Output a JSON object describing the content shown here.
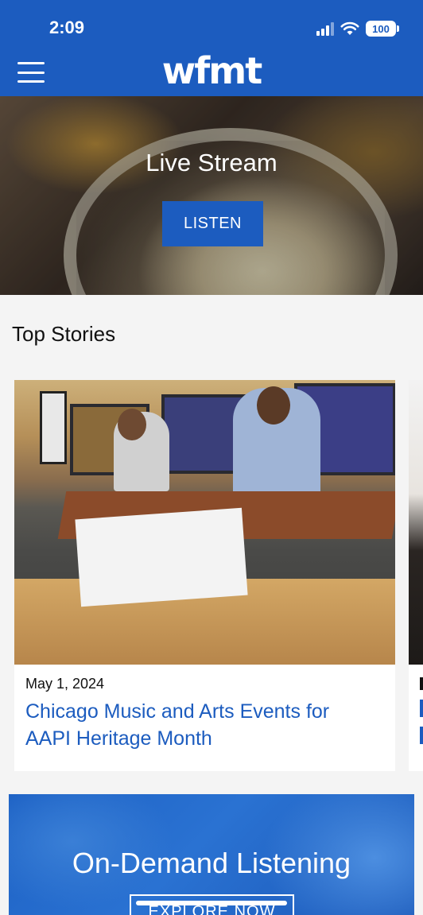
{
  "status_bar": {
    "time": "2:09",
    "battery": "100"
  },
  "header": {
    "logo": "wfmt"
  },
  "hero": {
    "title": "Live Stream",
    "button_label": "LISTEN"
  },
  "top_stories": {
    "section_title": "Top Stories",
    "cards": [
      {
        "date": "May 1, 2024",
        "title": "Chicago Music and Arts Events for AAPI Heritage Month"
      }
    ]
  },
  "on_demand": {
    "title": "On-Demand Listening",
    "button_label": "EXPLORE NOW"
  },
  "colors": {
    "brand_blue": "#1c5cbf",
    "background": "#f4f4f4"
  }
}
